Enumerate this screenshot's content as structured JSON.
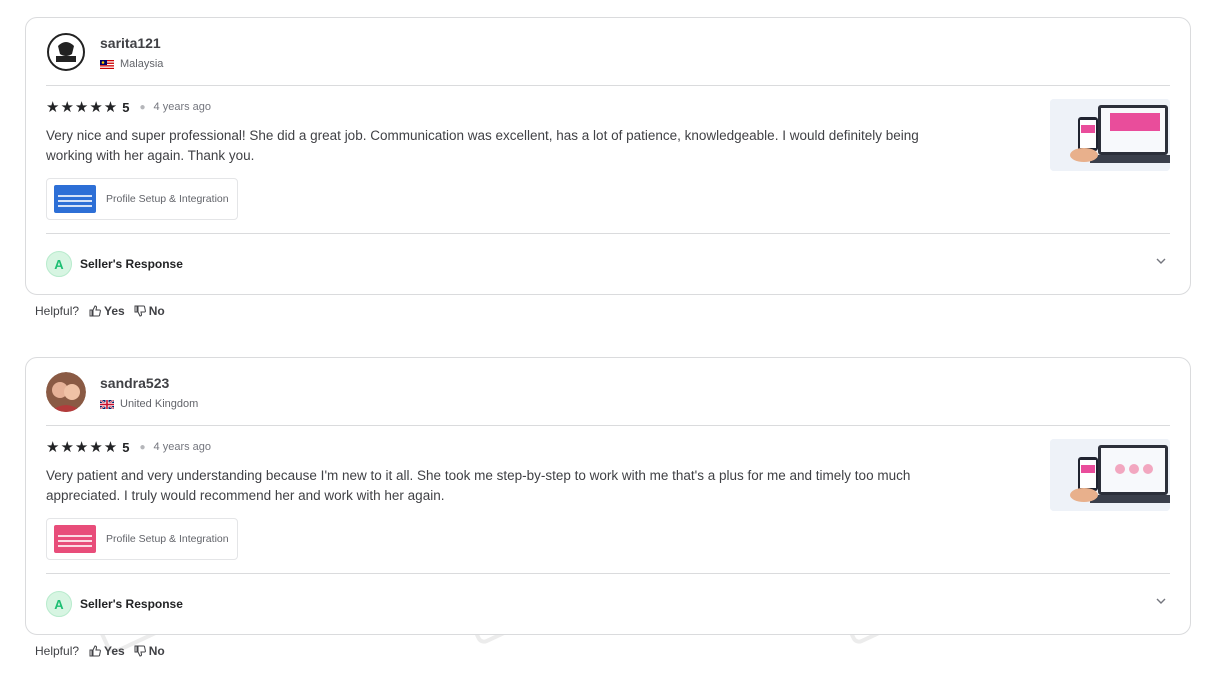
{
  "reviews": [
    {
      "username": "sarita121",
      "country": "Malaysia",
      "rating": "5",
      "stars": "★★★★★",
      "time_ago": "4 years ago",
      "text": "Very nice and super professional! She did a great job. Communication was excellent, has a lot of patience, knowledgeable. I would definitely being working with her again. Thank you.",
      "service": "Profile Setup & Integration",
      "seller_initial": "A",
      "seller_response_label": "Seller's Response"
    },
    {
      "username": "sandra523",
      "country": "United Kingdom",
      "rating": "5",
      "stars": "★★★★★",
      "time_ago": "4 years ago",
      "text": "Very patient and very understanding because I'm new to it all. She took me step-by-step to work with me that's a plus for me and timely too much appreciated. I truly would recommend her and work with her again.",
      "service": "Profile Setup & Integration",
      "seller_initial": "A",
      "seller_response_label": "Seller's Response"
    }
  ],
  "helpful": {
    "label": "Helpful?",
    "yes": "Yes",
    "no": "No"
  },
  "watermark": {
    "mark": "MM",
    "line1": "MENTOR",
    "line2": "GENIX"
  },
  "colors": {
    "accent_green": "#1dbf73",
    "text": "#404145",
    "border": "#dadbdd"
  }
}
